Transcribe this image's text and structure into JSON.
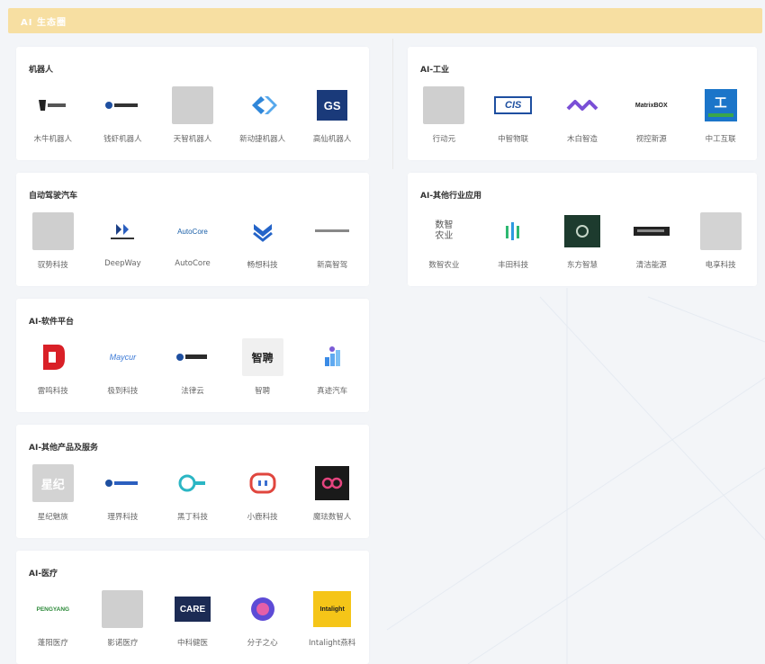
{
  "banner": {
    "title": "AI 生态圈"
  },
  "left": [
    {
      "title": "机器人",
      "items": [
        {
          "label": "木牛机器人",
          "icon": "muniu-logo"
        },
        {
          "label": "钱虾机器人",
          "icon": "qianxia-logo"
        },
        {
          "label": "天智机器人",
          "icon": "tianzhi-logo"
        },
        {
          "label": "新动捷机器人",
          "icon": "xindongjie-logo"
        },
        {
          "label": "高仙机器人",
          "icon": "gaoxian-logo",
          "logo_text": "GS"
        }
      ]
    },
    {
      "title": "自动驾驶汽车",
      "items": [
        {
          "label": "驭势科技",
          "icon": "yushi-logo"
        },
        {
          "label": "DeepWay",
          "icon": "deepway-logo"
        },
        {
          "label": "AutoCore",
          "icon": "autocore-logo",
          "logo_text": "AutoCore"
        },
        {
          "label": "畅想科技",
          "icon": "changxiang-logo"
        },
        {
          "label": "新高智驾",
          "icon": "xingao-logo"
        }
      ]
    },
    {
      "title": "AI-软件平台",
      "items": [
        {
          "label": "雷鸣科技",
          "icon": "leiming-logo"
        },
        {
          "label": "极到科技",
          "icon": "jidao-logo",
          "logo_text": "Maycur"
        },
        {
          "label": "法律云",
          "icon": "falvyun-logo"
        },
        {
          "label": "智聘",
          "icon": "zhipin-logo",
          "logo_text": "智聘"
        },
        {
          "label": "真迹汽车",
          "icon": "zhenji-logo"
        }
      ]
    },
    {
      "title": "AI-其他产品及服务",
      "items": [
        {
          "label": "星纪魅族",
          "icon": "xingji-logo",
          "logo_text": "星纪"
        },
        {
          "label": "理界科技",
          "icon": "lijie-logo"
        },
        {
          "label": "黑丁科技",
          "icon": "heiding-logo"
        },
        {
          "label": "小鹿科技",
          "icon": "xiaolu-logo"
        },
        {
          "label": "魔珐数智人",
          "icon": "mofa-logo"
        }
      ]
    },
    {
      "title": "AI-医疗",
      "items": [
        {
          "label": "蓬阳医疗",
          "icon": "pengyang-logo",
          "logo_text": "PENGYANG"
        },
        {
          "label": "影诺医疗",
          "icon": "yingnuo-logo"
        },
        {
          "label": "中科健医",
          "icon": "care-logo",
          "logo_text": "CARE"
        },
        {
          "label": "分子之心",
          "icon": "fenzi-logo"
        },
        {
          "label": "Intalight燕科",
          "icon": "intalight-logo",
          "logo_text": "Intalight"
        }
      ]
    }
  ],
  "right": [
    {
      "title": "AI-工业",
      "items": [
        {
          "label": "行动元",
          "icon": "xingdongyuan-logo"
        },
        {
          "label": "中智物联",
          "icon": "cis-logo",
          "logo_text": "CIS"
        },
        {
          "label": "木白智造",
          "icon": "mubai-logo"
        },
        {
          "label": "视控新源",
          "icon": "matrixbox-logo",
          "logo_text": "MatrixBOX"
        },
        {
          "label": "中工互联",
          "icon": "zhonggong-logo"
        }
      ]
    },
    {
      "title": "AI-其他行业应用",
      "items": [
        {
          "label": "数智农业",
          "icon": "shuzhi-logo",
          "logo_text": "数智\n农业"
        },
        {
          "label": "丰田科技",
          "icon": "fengtian-logo"
        },
        {
          "label": "东方智慧",
          "icon": "dongfang-logo"
        },
        {
          "label": "清洁能源",
          "icon": "qingjie-logo"
        },
        {
          "label": "电享科技",
          "icon": "dianxiang-logo"
        }
      ]
    }
  ]
}
